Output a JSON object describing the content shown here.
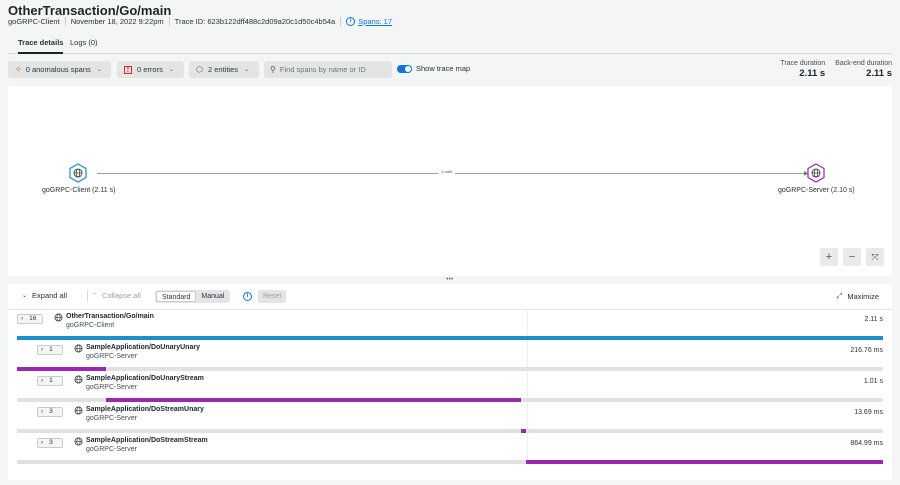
{
  "header": {
    "title": "OtherTransaction/Go/main",
    "entity": "goGRPC-Client",
    "date": "November 18, 2022 9:22pm",
    "trace_id": "Trace ID: 623b122dff488c2d09a20c1d50c4b54a",
    "spans_link": "Spans: 17"
  },
  "tabs": [
    {
      "label": "Trace details",
      "active": true
    },
    {
      "label": "Logs (0)",
      "active": false
    }
  ],
  "toolbar": {
    "anomalous": "0 anomalous spans",
    "errors": "0 errors",
    "entities": "2 entities",
    "search_placeholder": "Find spans by name or ID",
    "trace_map_toggle": "Show trace map",
    "trace_map_on": true
  },
  "durations": {
    "trace_label": "Trace duration",
    "trace_value": "2.11 s",
    "backend_label": "Back-end duration",
    "backend_value": "2.11 s"
  },
  "trace_map": {
    "client_label": "goGRPC-Client (2.11 s)",
    "server_label": "goGRPC-Server (2.10 s)",
    "edge_label": "4 calls",
    "client_color": "#1a8fc9",
    "server_color": "#9b27b0",
    "zoom_in": "+",
    "zoom_out": "−",
    "fit": "⤧"
  },
  "trace_controls": {
    "expand_all": "Expand all",
    "collapse_all": "Collapse all",
    "standard": "Standard",
    "manual": "Manual",
    "reset": "Reset",
    "maximize": "Maximize"
  },
  "spans": [
    {
      "count": "16",
      "name": "OtherTransaction/Go/main",
      "entity": "goGRPC-Client",
      "duration": "2.11 s",
      "start": 0.0,
      "width": 1.0,
      "color": "#1a8fc9"
    },
    {
      "count": "1",
      "name": "SampleApplication/DoUnaryUnary",
      "entity": "goGRPC-Server",
      "duration": "216.76 ms",
      "start": 0.0,
      "width": 0.103,
      "color": "#9b27b0"
    },
    {
      "count": "1",
      "name": "SampleApplication/DoUnaryStream",
      "entity": "goGRPC-Server",
      "duration": "1.01 s",
      "start": 0.103,
      "width": 0.479,
      "color": "#9b27b0"
    },
    {
      "count": "3",
      "name": "SampleApplication/DoStreamUnary",
      "entity": "goGRPC-Server",
      "duration": "13.69 ms",
      "start": 0.582,
      "width": 0.006,
      "color": "#9b27b0"
    },
    {
      "count": "3",
      "name": "SampleApplication/DoStreamStream",
      "entity": "goGRPC-Server",
      "duration": "864.99 ms",
      "start": 0.588,
      "width": 0.412,
      "color": "#9b27b0"
    }
  ]
}
